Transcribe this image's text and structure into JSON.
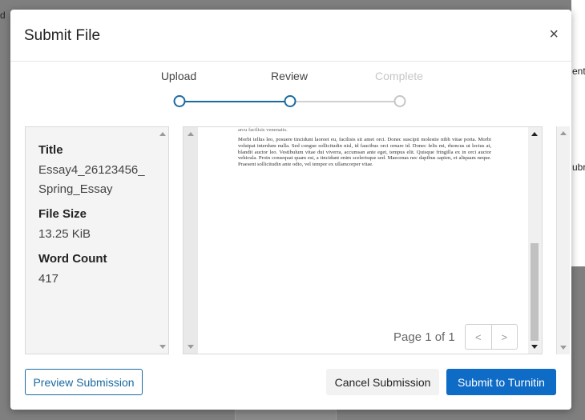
{
  "background": {
    "fragment_left": "d",
    "fragment_right_top": "ent",
    "fragment_right_mid": "ubr"
  },
  "modal": {
    "title": "Submit File",
    "close_icon": "×"
  },
  "stepper": {
    "steps": [
      {
        "label": "Upload",
        "state": "done"
      },
      {
        "label": "Review",
        "state": "current"
      },
      {
        "label": "Complete",
        "state": "pending"
      }
    ],
    "colors": {
      "active": "#1a6aa0",
      "inactive": "#c6c6c6"
    }
  },
  "file_info": {
    "title_label": "Title",
    "title_value_line1": "Essay4_26123456_",
    "title_value_line2": "Spring_Essay",
    "size_label": "File Size",
    "size_value": "13.25 KiB",
    "words_label": "Word Count",
    "words_value": "417"
  },
  "preview": {
    "top_fragment": "arcu facilisis venenatis.",
    "paragraph": "Morbi tellus leo, posuere tincidunt laoreet eu, facilisis sit amet orci. Donec suscipit molestie nibh vitae porta. Morbi volutpat interdum nulla. Sed congue sollicitudin nisl, id faucibus orci ornare id. Donec felis mi, rhoncus ut lectus at, blandit auctor leo. Vestibulum vitae dui viverra, accumsan ante eget, tempus elit. Quisque fringilla ex in orci auctor vehicula. Proin consequat quam est, a tincidunt enim scelerisque sed. Maecenas nec dapibus sapien, et aliquam neque. Praesent sollicitudin ante odio, vel tempor ex ullamcorper vitae.",
    "page_indicator": "Page 1 of 1",
    "prev_icon": "<",
    "next_icon": ">",
    "scroll_position": 0.55
  },
  "buttons": {
    "preview_submission": "Preview Submission",
    "cancel_submission": "Cancel Submission",
    "submit": "Submit to Turnitin"
  },
  "colors": {
    "primary": "#0e6bc6",
    "outline": "#1a6aa0"
  }
}
